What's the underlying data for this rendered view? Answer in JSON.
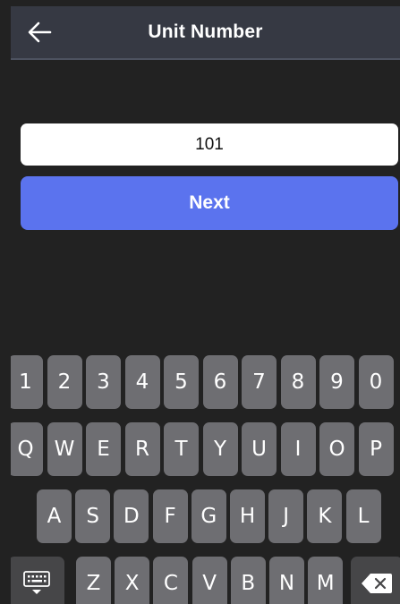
{
  "header": {
    "title": "Unit Number",
    "back_icon": "arrow-left-icon"
  },
  "form": {
    "unit_number_value": "101",
    "next_label": "Next",
    "accent_color": "#5b73ee"
  },
  "keyboard": {
    "row_numbers": [
      "1",
      "2",
      "3",
      "4",
      "5",
      "6",
      "7",
      "8",
      "9",
      "0"
    ],
    "row_top": [
      "Q",
      "W",
      "E",
      "R",
      "T",
      "Y",
      "U",
      "I",
      "O",
      "P"
    ],
    "row_middle": [
      "A",
      "S",
      "D",
      "F",
      "G",
      "H",
      "J",
      "K",
      "L"
    ],
    "row_bottom": [
      "Z",
      "X",
      "C",
      "V",
      "B",
      "N",
      "M"
    ],
    "hide_keyboard_icon": "keyboard-hide-icon",
    "backspace_icon": "backspace-icon"
  }
}
